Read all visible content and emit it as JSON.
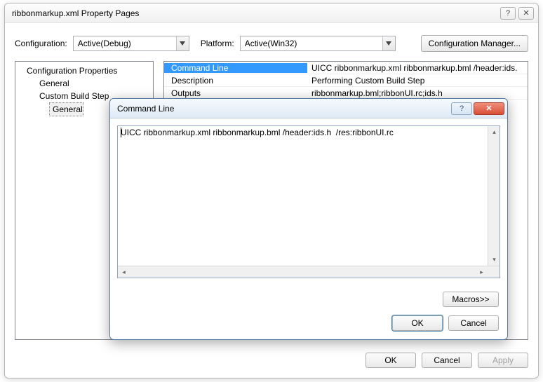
{
  "outer_window": {
    "title": "ribbonmarkup.xml Property Pages",
    "help_glyph": "?",
    "close_glyph": "✕"
  },
  "config_row": {
    "configuration_label": "Configuration:",
    "configuration_value": "Active(Debug)",
    "platform_label": "Platform:",
    "platform_value": "Active(Win32)",
    "manager_button": "Configuration Manager..."
  },
  "tree": {
    "root": "Configuration Properties",
    "items": [
      "General",
      "Custom Build Step"
    ],
    "leaf_selected": "General"
  },
  "grid": {
    "rows": [
      {
        "k": "Command Line",
        "v": "UICC ribbonmarkup.xml ribbonmarkup.bml /header:ids.",
        "selected": true
      },
      {
        "k": "Description",
        "v": "Performing Custom Build Step"
      },
      {
        "k": "Outputs",
        "v": "ribbonmarkup.bml;ribbonUI.rc;ids.h"
      }
    ]
  },
  "outer_footer": {
    "ok": "OK",
    "cancel": "Cancel",
    "apply": "Apply"
  },
  "inner_window": {
    "title": "Command Line",
    "help_glyph": "?",
    "close_glyph": "✕",
    "text_value": "UICC ribbonmarkup.xml ribbonmarkup.bml /header:ids.h  /res:ribbonUI.rc",
    "macros_button": "Macros>>",
    "ok": "OK",
    "cancel": "Cancel"
  }
}
